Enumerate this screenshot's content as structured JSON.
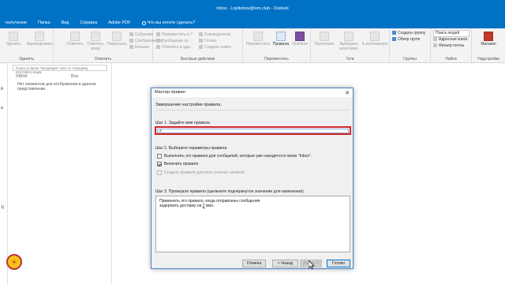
{
  "window": {
    "title": "Inbox - Lopitoboy@ixm.club - Outlook"
  },
  "tabs": [
    "получение",
    "Папка",
    "Вид",
    "Справка",
    "Adobe PDF"
  ],
  "tell_me": "Что вы хотите сделать?",
  "ribbon": {
    "delete_group": {
      "label": "Удалить",
      "delete": "Удалить",
      "archive": "Архивировать"
    },
    "respond_group": {
      "label": "Ответить",
      "reply": "Ответить",
      "reply_all": "Ответить всем",
      "forward": "Переслать",
      "meeting": "Собрание",
      "im": "Сообщение гру...",
      "more": "Больше"
    },
    "quick_group": {
      "label": "Быстрые действия",
      "items": [
        "Переместить в ?",
        "Сообщение гр...",
        "Ответить и уда..."
      ],
      "items2": [
        "Руководителю",
        "Готово",
        "Создать новое"
      ]
    },
    "move_group": {
      "label": "Переместить",
      "move": "Переместить",
      "rules": "Правила",
      "onenote": "OneNote"
    },
    "tags_group": {
      "label": "Теги",
      "read": "Прочитано",
      "categorize": "Выберите категорию",
      "followup": "К исполнению"
    },
    "groups_group": {
      "label": "Группы",
      "new_group": "Создать группу",
      "browse": "Обзор групп"
    },
    "find_group": {
      "people": "Поиск людей",
      "address_book": "Адресная книга",
      "filter": "Фильтр почты"
    },
    "addins_group": {
      "label": "Надстройки",
      "store": "Магазин"
    },
    "find_label": "Найти"
  },
  "folder_pane": {
    "items": [
      "й",
      "а"
    ],
    "mark": "1)"
  },
  "message_list": {
    "search_placeholder": "Поиск в папке \"Входящие\" или по текущему почтового ящик",
    "folder": "Inbox",
    "filter": "Все",
    "empty_text": "Нет элементов для отображения в данном представлении"
  },
  "dialog": {
    "title": "Мастер правил",
    "subtitle": "Завершение настройки правила.",
    "step1": "Шаг 1. Задайте имя правила",
    "name_value": "2",
    "step2": "Шаг 2. Выберите параметры правила",
    "opt_run_now": "Выполнить это правило для сообщений, которые уже находятся в папке \"Inbox\".",
    "opt_enable": "Включить правило",
    "opt_all_accounts": "Создать правило для всех учетных записей",
    "step3": "Шаг 3. Проверьте правило (щелкните подчеркнутое значение для изменения).",
    "preview_line1": "Применить это правило, когда отправлены сообщения",
    "preview_line2_prefix": "задержать доставку на ",
    "preview_link": "2",
    "preview_line2_suffix": " мин.",
    "btn_cancel": "Отмена",
    "btn_back": "< Назад",
    "btn_next": "Далее >",
    "btn_finish": "Готово"
  },
  "colors": {
    "accent": "#0072c6",
    "highlight": "#d0262b"
  }
}
